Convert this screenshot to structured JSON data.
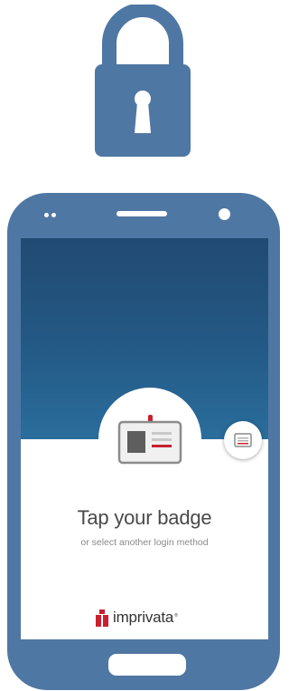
{
  "colors": {
    "lock_blue": "#4f77a3",
    "phone_body": "#4f77a3",
    "header_gradient_top": "#214a72",
    "header_gradient_bottom": "#2a6d9c",
    "brand_red": "#c8202f",
    "text_dark": "#4a4a4a",
    "text_muted": "#8a8a8a"
  },
  "icons": {
    "lock": "padlock-icon",
    "badge": "id-badge-icon",
    "alt_login": "card-icon",
    "brand": "imprivata-logo"
  },
  "login": {
    "title": "Tap your badge",
    "subtitle": "or select another login method"
  },
  "brand": {
    "name": "imprivata",
    "registered": "®"
  }
}
